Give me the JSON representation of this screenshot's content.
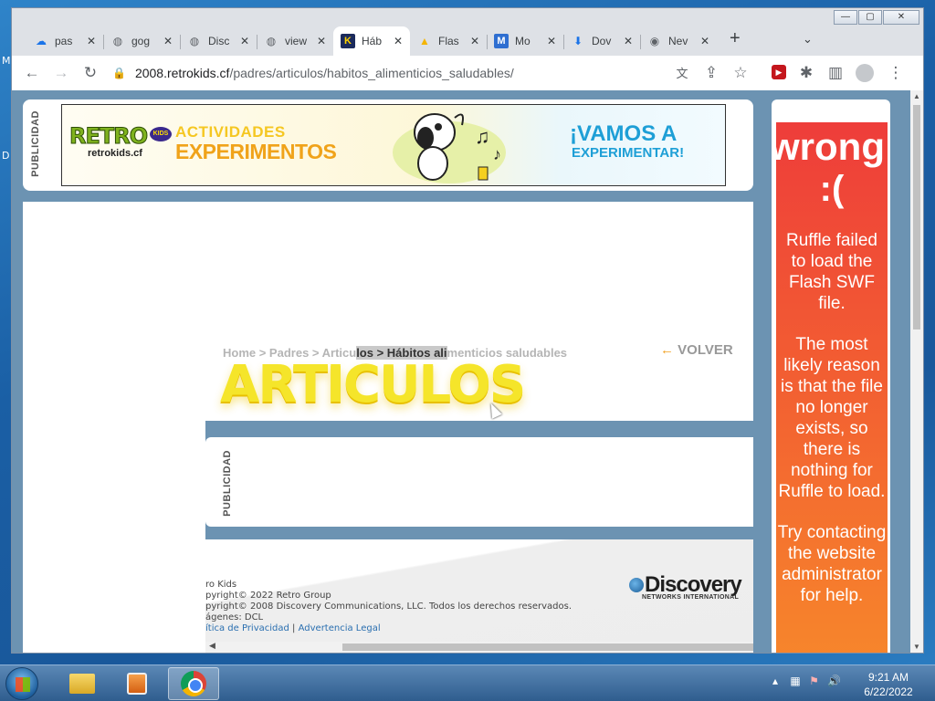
{
  "window": {
    "caption_minimize": "—",
    "caption_maximize": "▢",
    "caption_close": "✕"
  },
  "tabs": [
    {
      "title": "pas",
      "icon": "cloud-icon"
    },
    {
      "title": "gog",
      "icon": "globe-icon"
    },
    {
      "title": "Disc",
      "icon": "globe-icon"
    },
    {
      "title": "view",
      "icon": "globe-icon"
    },
    {
      "title": "Háb",
      "icon": "k-logo-icon",
      "active": true
    },
    {
      "title": "Flas",
      "icon": "drive-icon"
    },
    {
      "title": "Mo",
      "icon": "m-logo-icon"
    },
    {
      "title": "Dov",
      "icon": "download-icon"
    },
    {
      "title": "Nev",
      "icon": "chrome-icon"
    }
  ],
  "toolbar": {
    "url_host": "2008.retrokids.cf",
    "url_path": "/padres/articulos/habitos_alimenticios_saludables/",
    "ext_label": "▶"
  },
  "page": {
    "ad_label": "PUBLICIDAD",
    "banner": {
      "brand": "RETRO",
      "badge": "KIDS",
      "site": "retrokids.cf",
      "line1": "ACTIVIDADES",
      "line2": "EXPERIMENTOS",
      "cta1": "¡VAMOS A",
      "cta2": "EXPERIMENTAR!"
    },
    "breadcrumb": {
      "before": "Home > Padres > Articu",
      "selected": "los > Hábitos ali",
      "after": "menticios saludables"
    },
    "back_label": "VOLVER",
    "section_title": "ARTICULOS",
    "ad_label_2": "PUBLICIDAD",
    "footer": {
      "line1": "ro Kids",
      "line2": "pyright© 2022 Retro Group",
      "line3": "pyright© 2008 Discovery Communications, LLC.  Todos los derechos reservados.",
      "line4": "ágenes: DCL",
      "privacy": "ítica de Privacidad",
      "separator": "|",
      "legal": "Advertencia Legal",
      "discovery_brand": "Discovery",
      "discovery_sub": "NETWORKS INTERNATIONAL"
    }
  },
  "ruffle": {
    "headline": "wrong",
    "sad": ":(",
    "p1": "Ruffle failed to load the Flash SWF file.",
    "p2": "The most likely reason is that the file no longer exists, so there is nothing for Ruffle to load.",
    "p3": "Try contacting the website administrator for help."
  },
  "desktop": {
    "frag1": "M",
    "frag2": "D"
  },
  "taskbar": {
    "time": "9:21 AM",
    "date": "6/22/2022"
  },
  "colors": {
    "page_bg": "#6c93b2",
    "ruffle_top": "#ee3d3a",
    "ruffle_bottom": "#f7872b",
    "articulos_yellow": "#f5e52a"
  }
}
